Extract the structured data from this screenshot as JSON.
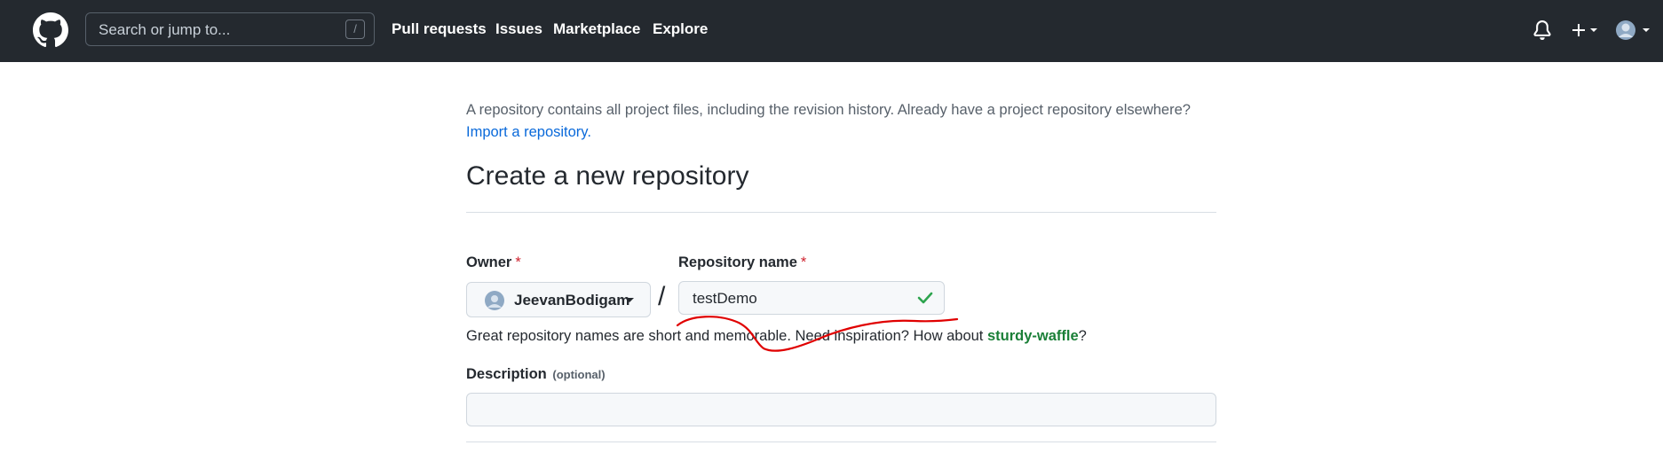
{
  "header": {
    "search_placeholder": "Search or jump to...",
    "search_shortcut": "/",
    "nav": [
      "Pull requests",
      "Issues",
      "Marketplace",
      "Explore"
    ]
  },
  "main": {
    "intro_text": "A repository contains all project files, including the revision history. Already have a project repository elsewhere?",
    "import_link": "Import a repository.",
    "title": "Create a new repository",
    "owner_label": "Owner",
    "required_mark": "*",
    "owner_value": "JeevanBodigam",
    "separator": "/",
    "repo_label": "Repository name",
    "repo_value": "testDemo",
    "hint_text": "Great repository names are short and memorable. Need inspiration? How about ",
    "suggestion": "sturdy-waffle",
    "hint_end": "?",
    "description_label": "Description",
    "description_optional": "(optional)",
    "description_value": ""
  },
  "colors": {
    "header_bg": "#24292f",
    "link": "#0969da",
    "success": "#1a7f37",
    "required": "#cf222e",
    "annotation": "#e00000"
  }
}
